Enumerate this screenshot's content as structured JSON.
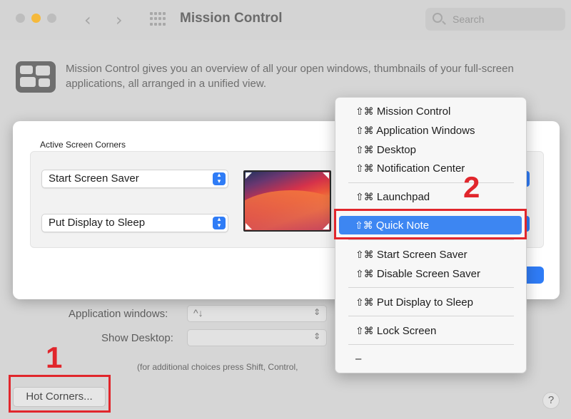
{
  "window": {
    "title": "Mission Control"
  },
  "search": {
    "placeholder": "Search"
  },
  "description": "Mission Control gives you an overview of all your open windows, thumbnails of your full-screen applications, all arranged in a unified view.",
  "background": {
    "app_windows_label": "Application windows:",
    "app_windows_value": "^↓",
    "show_desktop_label": "Show Desktop:",
    "show_desktop_value": "",
    "hint": "(for additional choices press Shift, Control,",
    "hot_corners_button": "Hot Corners...",
    "help": "?"
  },
  "sheet": {
    "title": "Active Screen Corners",
    "top_left": "Start Screen Saver",
    "bottom_left": "Put Display to Sleep"
  },
  "menu": {
    "modifier": "⇧⌘",
    "items": [
      "Mission Control",
      "Application Windows",
      "Desktop",
      "Notification Center",
      "Launchpad",
      "Quick Note",
      "Start Screen Saver",
      "Disable Screen Saver",
      "Put Display to Sleep",
      "Lock Screen"
    ],
    "selected": "Quick Note",
    "last_item": "–"
  },
  "annotations": {
    "step1": "1",
    "step2": "2"
  },
  "colors": {
    "accent": "#2f7cf6",
    "highlight": "#3d86f2",
    "annotation": "#e1262c"
  }
}
